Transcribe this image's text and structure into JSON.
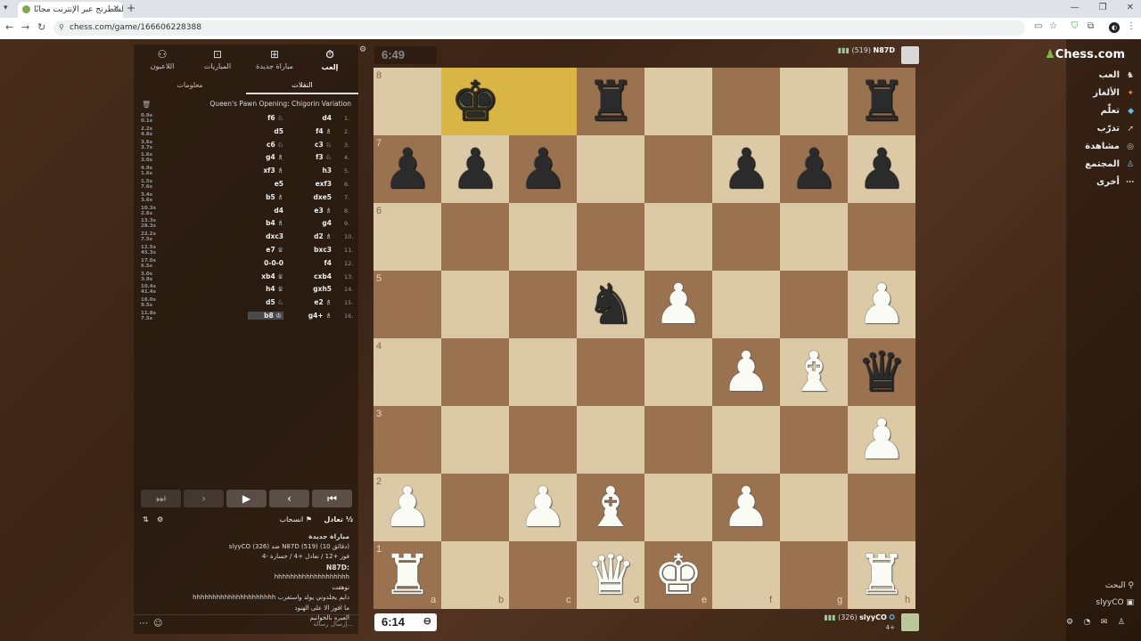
{
  "browser": {
    "tab_title": "العب الشطرنج عبر الإنترنت مجانًا",
    "url": "chess.com/game/166606228388",
    "wincontrols": [
      "—",
      "❐",
      "✕"
    ]
  },
  "sidebar": {
    "logo": "Chess.com",
    "items": [
      {
        "label": "العب",
        "icon": "play-icon"
      },
      {
        "label": "الألغاز",
        "icon": "puzzle-icon"
      },
      {
        "label": "تعلّم",
        "icon": "learn-icon"
      },
      {
        "label": "تدرّب",
        "icon": "practice-icon"
      },
      {
        "label": "مشاهدة",
        "icon": "watch-icon"
      },
      {
        "label": "المجتمع",
        "icon": "community-icon"
      },
      {
        "label": "أخرى",
        "icon": "more-icon"
      }
    ],
    "search": "البحث",
    "username": "slyyCO"
  },
  "panel": {
    "top_tabs": [
      {
        "label": "إلعب",
        "icon": "clock-icon"
      },
      {
        "label": "مباراة جديدة",
        "icon": "plus-icon"
      },
      {
        "label": "المباريات",
        "icon": "games-icon"
      },
      {
        "label": "اللاعبون",
        "icon": "players-icon"
      }
    ],
    "sub_tabs": [
      "النقلات",
      "معلومات"
    ],
    "opening": "Queen's Pawn Opening: Chigorin Variation",
    "moves": [
      {
        "n": "1.",
        "w": "d4",
        "b": "f6 ♘",
        "tw": "0.9s",
        "tb": "0.1s"
      },
      {
        "n": "2.",
        "w": "f4 ♗",
        "b": "d5",
        "tw": "2.2s",
        "tb": "4.8s"
      },
      {
        "n": "3.",
        "w": "c3 ♘",
        "b": "c6 ♘",
        "tw": "3.6s",
        "tb": "3.7s"
      },
      {
        "n": "4.",
        "w": "f3 ♘",
        "b": "g4 ♗",
        "tw": "1.6s",
        "tb": "3.0s"
      },
      {
        "n": "5.",
        "w": "h3",
        "b": "xf3 ♗",
        "tw": "4.9s",
        "tb": "1.6s"
      },
      {
        "n": "6.",
        "w": "exf3",
        "b": "e5",
        "tw": "1.5s",
        "tb": "7.6s"
      },
      {
        "n": "7.",
        "w": "dxe5",
        "b": "b5 ♗",
        "tw": "3.4s",
        "tb": "3.6s"
      },
      {
        "n": "8.",
        "w": "e3 ♗",
        "b": "d4",
        "tw": "10.3s",
        "tb": "2.6s"
      },
      {
        "n": "9.",
        "w": "g4",
        "b": "b4 ♗",
        "tw": "13.3s",
        "tb": "28.3s"
      },
      {
        "n": "10.",
        "w": "d2 ♗",
        "b": "dxc3",
        "tw": "22.2s",
        "tb": "7.5s"
      },
      {
        "n": "11.",
        "w": "bxc3",
        "b": "e7 ♕",
        "tw": "12.5s",
        "tb": "45.3s"
      },
      {
        "n": "12.",
        "w": "f4",
        "b": "0-0-0",
        "tw": "17.0s",
        "tb": "6.5s"
      },
      {
        "n": "13.",
        "w": "cxb4",
        "b": "xb4 ♕",
        "tw": "3.0s",
        "tb": "3.9s"
      },
      {
        "n": "14.",
        "w": "gxh5",
        "b": "h4 ♕",
        "tw": "10.4s",
        "tb": "41.4s"
      },
      {
        "n": "15.",
        "w": "e2 ♗",
        "b": "d5 ♘",
        "tw": "16.0s",
        "tb": "9.5s"
      },
      {
        "n": "16.",
        "w": "g4+ ♗",
        "b": "b8 ♔",
        "tw": "11.8s",
        "tb": "7.5s"
      }
    ],
    "controls": [
      "⏮",
      "‹",
      "▶",
      "›",
      "⏭"
    ],
    "draw_label": "تعادل",
    "resign_label": "انسحاب",
    "draw_glyph": "½",
    "chat": [
      {
        "text": "مباراة جديدة",
        "bold": true
      },
      {
        "text": "slyyCO (326) ضد N87D (519) (10 دقائق)",
        "bold": false
      },
      {
        "text": "فوز +12 / تعادل +4 / خسارة -4",
        "bold": false
      },
      {
        "text": "N87D:",
        "bold": true
      },
      {
        "text": "hhhhhhhhhhhhhhhhhhh",
        "bold": false
      },
      {
        "text": "توهقت",
        "bold": false
      },
      {
        "text": "hhhhhhhhhhhhhhhhhhhhh دايم يجلدوني يولد واستغرب",
        "bold": false
      },
      {
        "text": "ما افوز الا على الهنود",
        "bold": false
      },
      {
        "text": "العبره بالخواتيم",
        "bold": false
      }
    ],
    "chat_placeholder": "إرسال رسالة..."
  },
  "game": {
    "top_clock": "6:49",
    "bottom_clock": "6:14",
    "top_player": {
      "name": "N87D",
      "rating": "(519)"
    },
    "bottom_player": {
      "name": "slyyCO",
      "rating": "(326)",
      "sub": "4+"
    },
    "highlighted": [
      "b8",
      "c8"
    ],
    "files": [
      "a",
      "b",
      "c",
      "d",
      "e",
      "f",
      "g",
      "h"
    ],
    "ranks": [
      "8",
      "7",
      "6",
      "5",
      "4",
      "3",
      "2",
      "1"
    ],
    "pieces": [
      {
        "sq": "b8",
        "g": "♚",
        "c": "b"
      },
      {
        "sq": "d8",
        "g": "♜",
        "c": "b"
      },
      {
        "sq": "h8",
        "g": "♜",
        "c": "b"
      },
      {
        "sq": "a7",
        "g": "♟",
        "c": "b"
      },
      {
        "sq": "b7",
        "g": "♟",
        "c": "b"
      },
      {
        "sq": "c7",
        "g": "♟",
        "c": "b"
      },
      {
        "sq": "f7",
        "g": "♟",
        "c": "b"
      },
      {
        "sq": "g7",
        "g": "♟",
        "c": "b"
      },
      {
        "sq": "h7",
        "g": "♟",
        "c": "b"
      },
      {
        "sq": "d5",
        "g": "♞",
        "c": "b"
      },
      {
        "sq": "e5",
        "g": "♟",
        "c": "w"
      },
      {
        "sq": "h5",
        "g": "♟",
        "c": "w"
      },
      {
        "sq": "f4",
        "g": "♟",
        "c": "w"
      },
      {
        "sq": "g4",
        "g": "♝",
        "c": "w"
      },
      {
        "sq": "h4",
        "g": "♛",
        "c": "b"
      },
      {
        "sq": "h3",
        "g": "♟",
        "c": "w"
      },
      {
        "sq": "a2",
        "g": "♟",
        "c": "w"
      },
      {
        "sq": "c2",
        "g": "♟",
        "c": "w"
      },
      {
        "sq": "d2",
        "g": "♝",
        "c": "w"
      },
      {
        "sq": "f2",
        "g": "♟",
        "c": "w"
      },
      {
        "sq": "a1",
        "g": "♜",
        "c": "w"
      },
      {
        "sq": "d1",
        "g": "♛",
        "c": "w"
      },
      {
        "sq": "e1",
        "g": "♚",
        "c": "w"
      },
      {
        "sq": "h1",
        "g": "♜",
        "c": "w"
      }
    ]
  }
}
